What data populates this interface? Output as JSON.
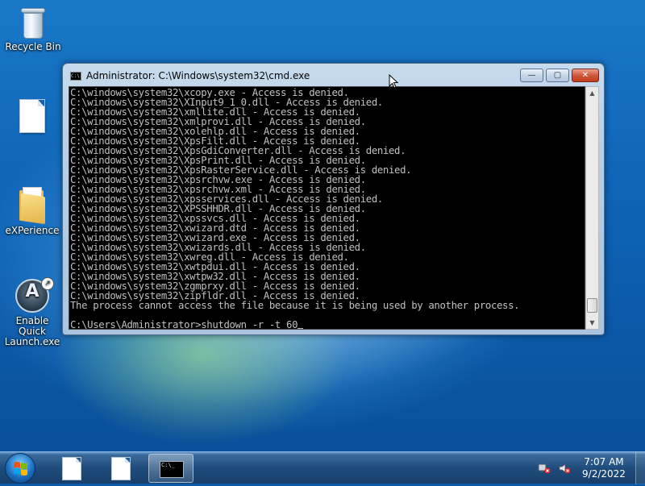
{
  "desktop": {
    "icons": [
      {
        "label": "Recycle Bin",
        "icon": "recycle-bin-icon"
      },
      {
        "label": "",
        "icon": "document-icon"
      },
      {
        "label": "eXPerience",
        "icon": "folder-icon"
      },
      {
        "label": "Enable Quick Launch.exe",
        "icon": "quick-launch-icon"
      }
    ]
  },
  "window": {
    "title": "Administrator: C:\\Windows\\system32\\cmd.exe",
    "minimize": "—",
    "maximize": "▢",
    "close": "✕",
    "lines": [
      "C:\\windows\\system32\\xcopy.exe - Access is denied.",
      "C:\\windows\\system32\\XInput9_1_0.dll - Access is denied.",
      "C:\\windows\\system32\\xmllite.dll - Access is denied.",
      "C:\\windows\\system32\\xmlprovi.dll - Access is denied.",
      "C:\\windows\\system32\\xolehlp.dll - Access is denied.",
      "C:\\windows\\system32\\XpsFilt.dll - Access is denied.",
      "C:\\windows\\system32\\XpsGdiConverter.dll - Access is denied.",
      "C:\\windows\\system32\\XpsPrint.dll - Access is denied.",
      "C:\\windows\\system32\\XpsRasterService.dll - Access is denied.",
      "C:\\windows\\system32\\xpsrchvw.exe - Access is denied.",
      "C:\\windows\\system32\\xpsrchvw.xml - Access is denied.",
      "C:\\windows\\system32\\xpsservices.dll - Access is denied.",
      "C:\\windows\\system32\\XPSSHHDR.dll - Access is denied.",
      "C:\\windows\\system32\\xpssvcs.dll - Access is denied.",
      "C:\\windows\\system32\\xwizard.dtd - Access is denied.",
      "C:\\windows\\system32\\xwizard.exe - Access is denied.",
      "C:\\windows\\system32\\xwizards.dll - Access is denied.",
      "C:\\windows\\system32\\xwreg.dll - Access is denied.",
      "C:\\windows\\system32\\xwtpdui.dll - Access is denied.",
      "C:\\windows\\system32\\xwtpw32.dll - Access is denied.",
      "C:\\windows\\system32\\zgmprxy.dll - Access is denied.",
      "C:\\windows\\system32\\zipfldr.dll - Access is denied.",
      "The process cannot access the file because it is being used by another process.",
      ""
    ],
    "prompt": "C:\\Users\\Administrator>shutdown -r -t 60"
  },
  "taskbar": {
    "items": [
      {
        "icon": "document-icon",
        "active": false
      },
      {
        "icon": "document-icon",
        "active": false
      },
      {
        "icon": "command-prompt-icon",
        "active": true
      }
    ],
    "cmd_icon_text": "C:\\_",
    "time": "7:07 AM",
    "date": "9/2/2022"
  }
}
